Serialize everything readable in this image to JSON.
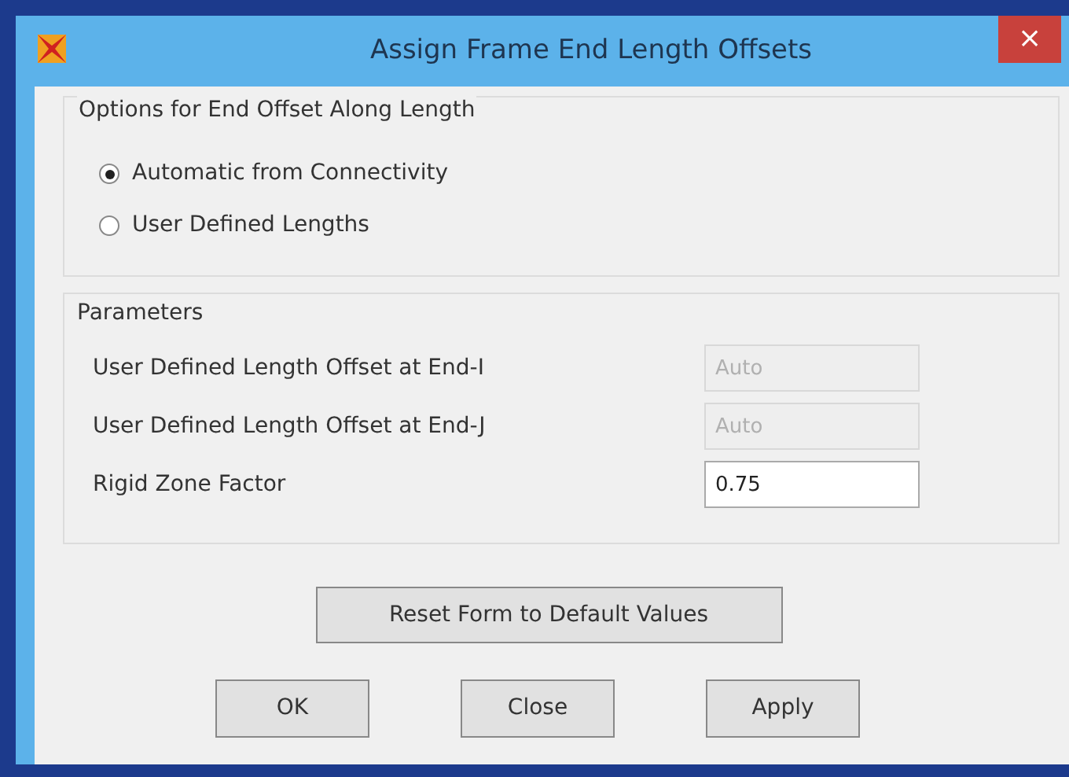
{
  "window": {
    "title": "Assign Frame End Length Offsets",
    "close": "×"
  },
  "options": {
    "title": "Options for End Offset Along Length",
    "radios": [
      {
        "label": "Automatic from Connectivity",
        "selected": true
      },
      {
        "label": "User Defined Lengths",
        "selected": false
      }
    ]
  },
  "parameters": {
    "title": "Parameters",
    "fields": [
      {
        "label": "User Defined Length Offset at End-I",
        "value": "Auto",
        "disabled": true
      },
      {
        "label": "User Defined Length Offset at End-J",
        "value": "Auto",
        "disabled": true
      },
      {
        "label": "Rigid Zone Factor",
        "value": "0.75",
        "disabled": false
      }
    ]
  },
  "reset_button": "Reset Form to Default Values",
  "buttons": [
    "OK",
    "Close",
    "Apply"
  ]
}
